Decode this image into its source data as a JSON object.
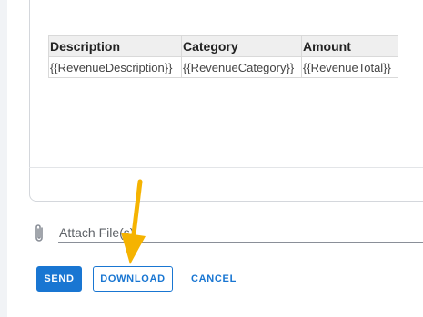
{
  "template_table": {
    "headers": [
      "Description",
      "Category",
      "Amount"
    ],
    "row": [
      "{{RevenueDescription}}",
      "{{RevenueCategory}}",
      "{{RevenueTotal}}"
    ]
  },
  "attach": {
    "placeholder": "Attach File(s)",
    "icon": "paperclip-icon"
  },
  "actions": {
    "send_label": "SEND",
    "download_label": "DOWNLOAD",
    "cancel_label": "CANCEL"
  },
  "colors": {
    "primary": "#1976d2",
    "annotation_arrow": "#f5b301"
  }
}
